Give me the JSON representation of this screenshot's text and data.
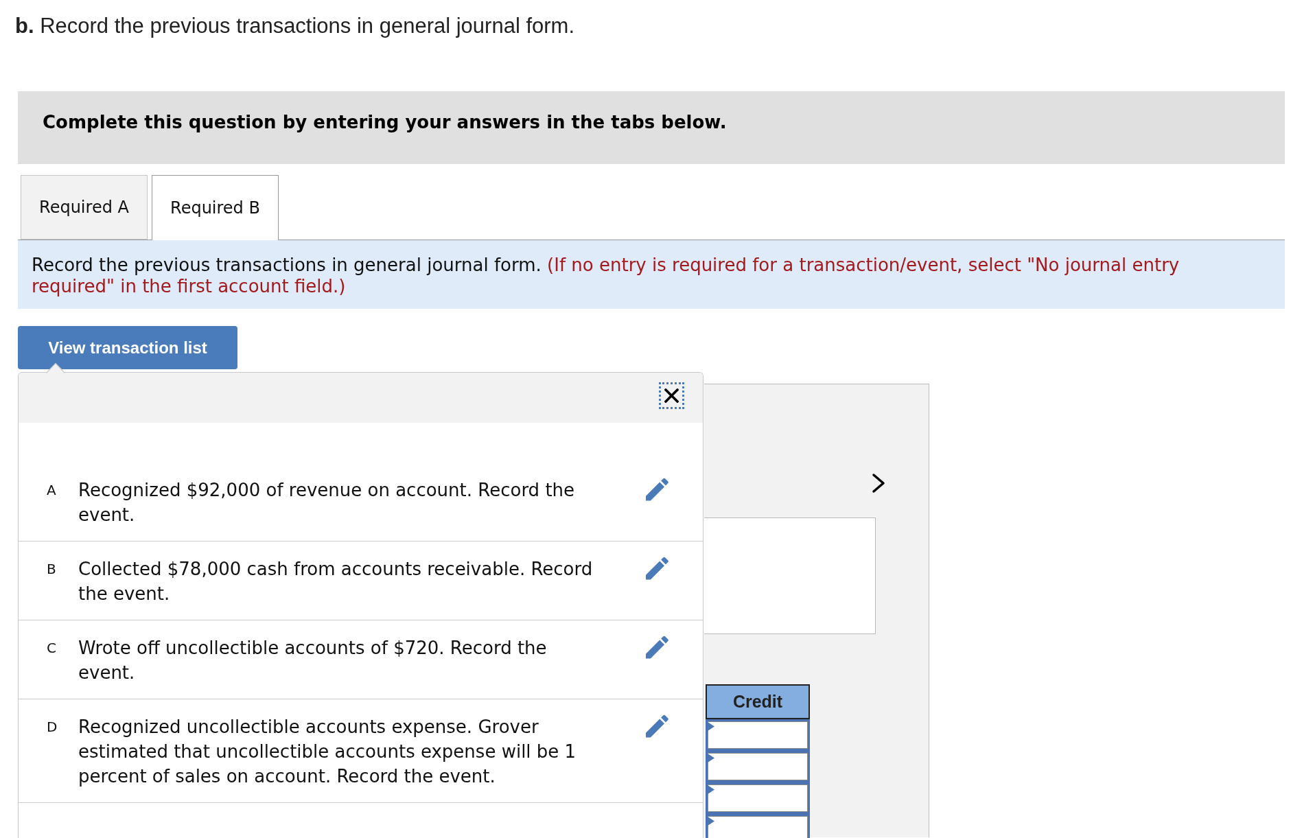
{
  "heading": "**b.** Record the previous transactions in general journal form.",
  "banner": {
    "text": "Complete this question by entering your answers in the tabs below."
  },
  "tabs": [
    {
      "label": "Required A",
      "selected": false
    },
    {
      "label": "Required B",
      "selected": true
    }
  ],
  "instruction": {
    "text": "Record the previous transactions in general journal form.",
    "note": "(If no entry is required for a transaction/event, select \"No journal entry required\" in the first account field.)"
  },
  "view_button": {
    "label": "View transaction list"
  },
  "transaction_list": {
    "items": [
      {
        "letter": "A",
        "text": "Recognized $92,000 of revenue on account. Record the event."
      },
      {
        "letter": "B",
        "text": "Collected $78,000 cash from accounts receivable. Record the event."
      },
      {
        "letter": "C",
        "text": "Wrote off uncollectible accounts of $720. Record the event."
      },
      {
        "letter": "D",
        "text": "Recognized uncollectible accounts expense. Grover estimated that uncollectible accounts expense will be 1 percent of sales on account. Record the event."
      }
    ]
  },
  "worksheet": {
    "credit_column": {
      "header": "Credit",
      "cells": [
        {
          "flagged": true
        },
        {
          "flagged": true
        },
        {
          "flagged": true
        },
        {
          "flagged": true
        }
      ]
    }
  }
}
